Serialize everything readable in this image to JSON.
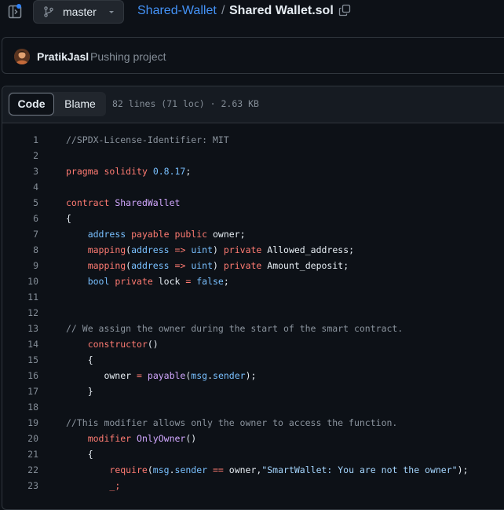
{
  "topbar": {
    "branch": "master",
    "repo": "Shared-Wallet",
    "separator": "/",
    "file": "Shared Wallet.sol"
  },
  "commit": {
    "author": "PratikJasl",
    "message": "Pushing project"
  },
  "file_header": {
    "tab_code": "Code",
    "tab_blame": "Blame",
    "meta": "82 lines (71 loc) · 2.63 KB"
  },
  "colors": {
    "background": "#0d1117",
    "link": "#4493f8",
    "keyword": "#ff7b72",
    "type": "#79c0ff",
    "function": "#d2a8ff",
    "comment": "#8b949e"
  },
  "code": [
    {
      "n": "1",
      "tokens": [
        [
          "com",
          "//SPDX-License-Identifier: MIT"
        ]
      ]
    },
    {
      "n": "2",
      "tokens": []
    },
    {
      "n": "3",
      "tokens": [
        [
          "kw",
          "pragma"
        ],
        [
          "",
          " "
        ],
        [
          "kw",
          "solidity"
        ],
        [
          "",
          " "
        ],
        [
          "ty",
          "0.8.17"
        ],
        [
          "",
          ";"
        ]
      ]
    },
    {
      "n": "4",
      "tokens": []
    },
    {
      "n": "5",
      "tokens": [
        [
          "kw",
          "contract"
        ],
        [
          "",
          " "
        ],
        [
          "fn",
          "SharedWallet"
        ]
      ]
    },
    {
      "n": "6",
      "tokens": [
        [
          "",
          "{"
        ]
      ]
    },
    {
      "n": "7",
      "tokens": [
        [
          "",
          "    "
        ],
        [
          "ty",
          "address"
        ],
        [
          "",
          " "
        ],
        [
          "kw",
          "payable"
        ],
        [
          "",
          " "
        ],
        [
          "kw",
          "public"
        ],
        [
          "",
          " owner;"
        ]
      ]
    },
    {
      "n": "8",
      "tokens": [
        [
          "",
          "    "
        ],
        [
          "kw",
          "mapping"
        ],
        [
          "",
          "("
        ],
        [
          "ty",
          "address"
        ],
        [
          "",
          " "
        ],
        [
          "kw",
          "=>"
        ],
        [
          "",
          " "
        ],
        [
          "ty",
          "uint"
        ],
        [
          "",
          ") "
        ],
        [
          "kw",
          "private"
        ],
        [
          "",
          " Allowed_address;"
        ]
      ]
    },
    {
      "n": "9",
      "tokens": [
        [
          "",
          "    "
        ],
        [
          "kw",
          "mapping"
        ],
        [
          "",
          "("
        ],
        [
          "ty",
          "address"
        ],
        [
          "",
          " "
        ],
        [
          "kw",
          "=>"
        ],
        [
          "",
          " "
        ],
        [
          "ty",
          "uint"
        ],
        [
          "",
          ") "
        ],
        [
          "kw",
          "private"
        ],
        [
          "",
          " Amount_deposit;"
        ]
      ]
    },
    {
      "n": "10",
      "tokens": [
        [
          "",
          "    "
        ],
        [
          "ty",
          "bool"
        ],
        [
          "",
          " "
        ],
        [
          "kw",
          "private"
        ],
        [
          "",
          " lock "
        ],
        [
          "kw",
          "="
        ],
        [
          "",
          " "
        ],
        [
          "ty",
          "false"
        ],
        [
          "",
          ";"
        ]
      ]
    },
    {
      "n": "11",
      "tokens": []
    },
    {
      "n": "12",
      "tokens": []
    },
    {
      "n": "13",
      "tokens": [
        [
          "com",
          "// We assign the owner during the start of the smart contract."
        ]
      ]
    },
    {
      "n": "14",
      "tokens": [
        [
          "",
          "    "
        ],
        [
          "kw",
          "constructor"
        ],
        [
          "",
          "()"
        ]
      ]
    },
    {
      "n": "15",
      "tokens": [
        [
          "",
          "    {"
        ]
      ]
    },
    {
      "n": "16",
      "tokens": [
        [
          "",
          "       owner "
        ],
        [
          "kw",
          "="
        ],
        [
          "",
          " "
        ],
        [
          "fn",
          "payable"
        ],
        [
          "",
          "("
        ],
        [
          "ty",
          "msg"
        ],
        [
          "",
          "."
        ],
        [
          "ty",
          "sender"
        ],
        [
          "",
          ");"
        ]
      ]
    },
    {
      "n": "17",
      "tokens": [
        [
          "",
          "    }"
        ]
      ]
    },
    {
      "n": "18",
      "tokens": []
    },
    {
      "n": "19",
      "tokens": [
        [
          "com",
          "//This modifier allows only the owner to access the function."
        ]
      ]
    },
    {
      "n": "20",
      "tokens": [
        [
          "",
          "    "
        ],
        [
          "kw",
          "modifier"
        ],
        [
          "",
          " "
        ],
        [
          "fn",
          "OnlyOwner"
        ],
        [
          "",
          "()"
        ]
      ]
    },
    {
      "n": "21",
      "tokens": [
        [
          "",
          "    {"
        ]
      ]
    },
    {
      "n": "22",
      "tokens": [
        [
          "",
          "        "
        ],
        [
          "kw",
          "require"
        ],
        [
          "",
          "("
        ],
        [
          "ty",
          "msg"
        ],
        [
          "",
          "."
        ],
        [
          "ty",
          "sender"
        ],
        [
          "",
          " "
        ],
        [
          "kw",
          "=="
        ],
        [
          "",
          " owner,"
        ],
        [
          "str",
          "\"SmartWallet: You are not the owner\""
        ],
        [
          "",
          ");"
        ]
      ]
    },
    {
      "n": "23",
      "tokens": [
        [
          "",
          "        "
        ],
        [
          "kw",
          "_;"
        ]
      ]
    }
  ]
}
